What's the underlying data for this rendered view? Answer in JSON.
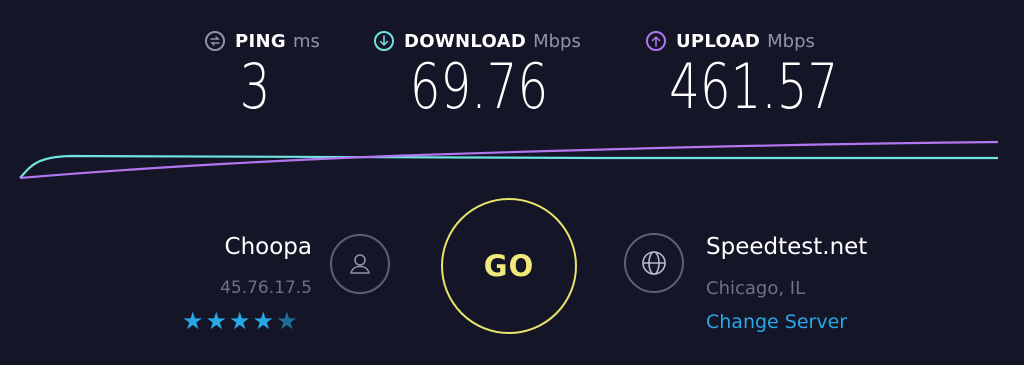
{
  "metrics": {
    "ping": {
      "label": "PING",
      "unit": "ms",
      "value": "3",
      "icon": "ping-icon"
    },
    "download": {
      "label": "DOWNLOAD",
      "unit": "Mbps",
      "value": "69.76",
      "icon": "download-arrow-icon"
    },
    "upload": {
      "label": "UPLOAD",
      "unit": "Mbps",
      "value": "461.57",
      "icon": "upload-arrow-icon"
    }
  },
  "colors": {
    "background": "#141526",
    "download": "#6fe3e1",
    "upload": "#b276f0",
    "go": "#e7e36b",
    "accent": "#26a9e6",
    "muted": "#6e7086"
  },
  "isp": {
    "name": "Choopa",
    "ip": "45.76.17.5",
    "rating": 4.5,
    "rating_max": 5,
    "icon": "user-icon"
  },
  "go_button": {
    "label": "GO"
  },
  "server": {
    "name": "Speedtest.net",
    "location": "Chicago, IL",
    "change_label": "Change Server",
    "icon": "globe-icon"
  }
}
